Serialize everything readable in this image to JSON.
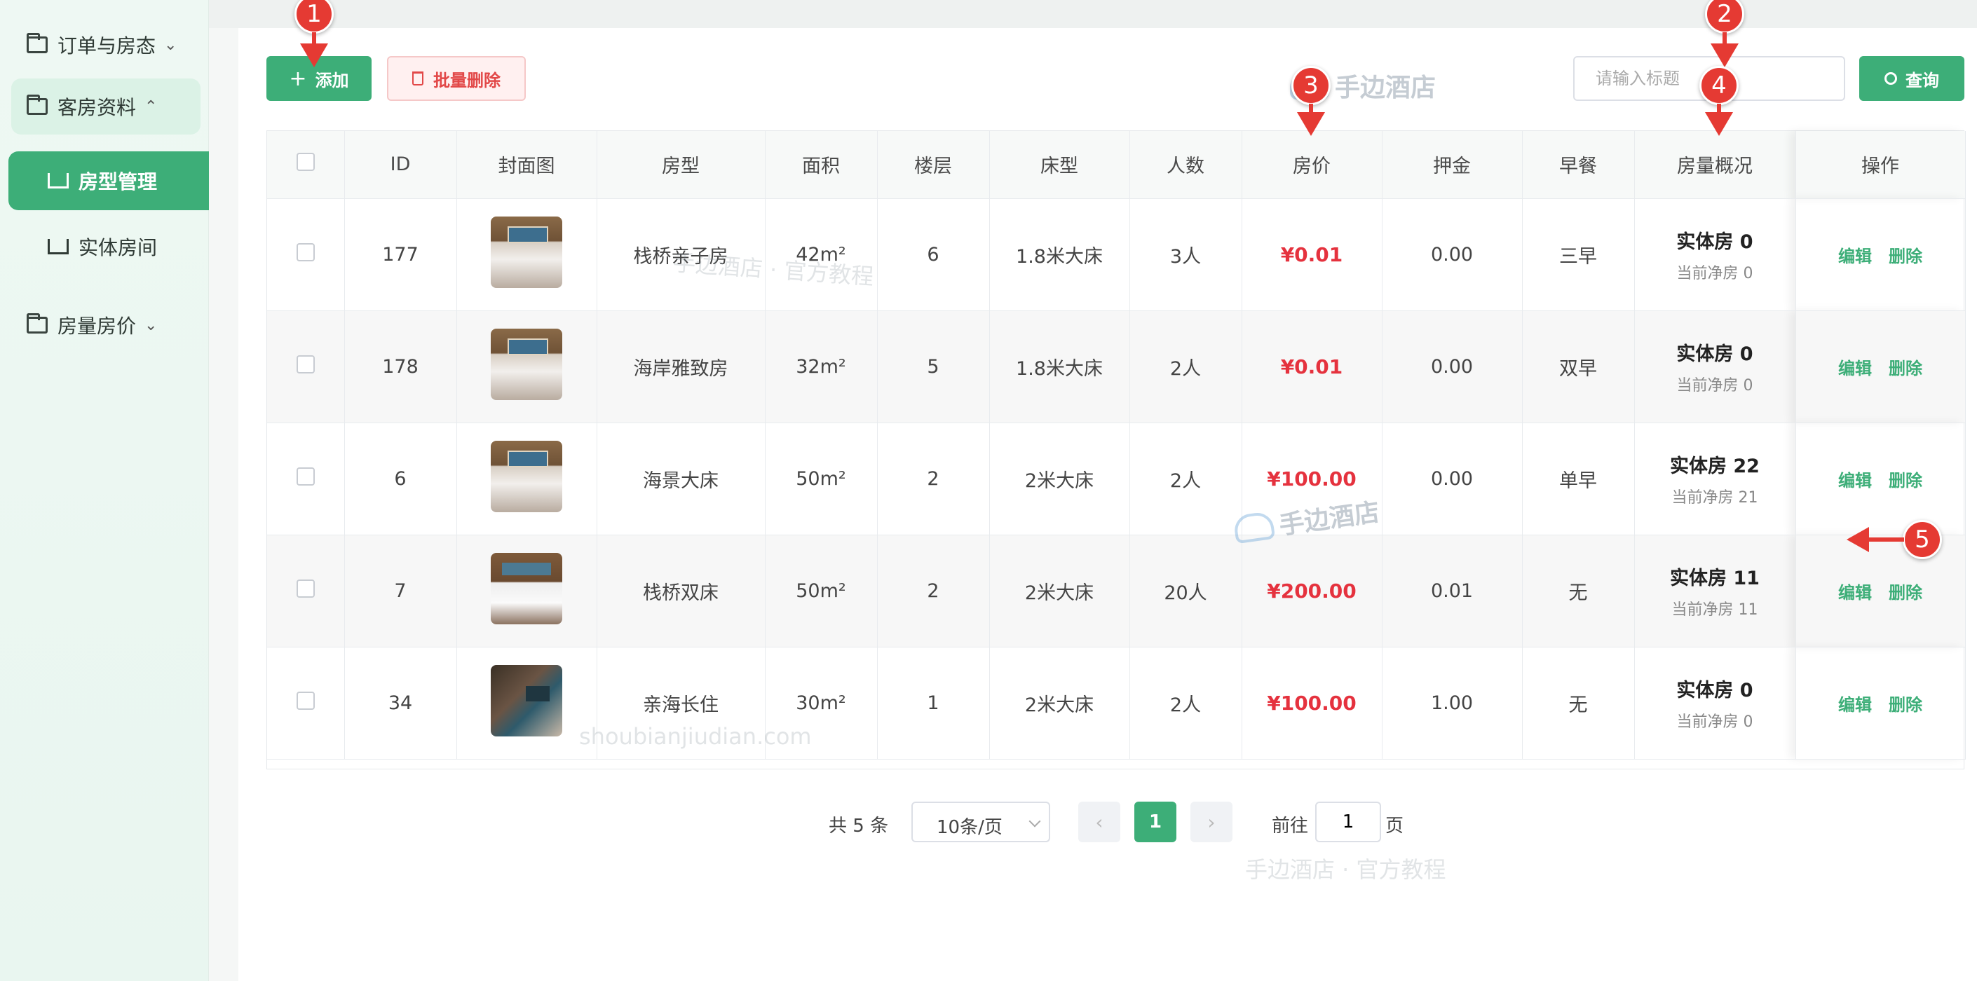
{
  "sidebar": {
    "groups": [
      {
        "label": "订单与房态",
        "chevron": "chevron-down-icon"
      },
      {
        "label": "客房资料",
        "chevron": "chevron-up-icon"
      },
      {
        "label": "房量房价",
        "chevron": "chevron-down-icon"
      }
    ],
    "sub_items": [
      {
        "label": "房型管理",
        "active": true
      },
      {
        "label": "实体房间",
        "active": false
      }
    ]
  },
  "toolbar": {
    "add_label": "添加",
    "batch_delete_label": "批量删除",
    "search_placeholder": "请输入标题",
    "query_label": "查询"
  },
  "table": {
    "headers": [
      "",
      "ID",
      "封面图",
      "房型",
      "面积",
      "楼层",
      "床型",
      "人数",
      "房价",
      "押金",
      "早餐",
      "房量概况",
      "操作"
    ],
    "rows": [
      {
        "id": "177",
        "thumb": "bed",
        "room_type": "栈桥亲子房",
        "area": "42m²",
        "floor": "6",
        "bed": "1.8米大床",
        "people": "3人",
        "price": "¥0.01",
        "deposit": "0.00",
        "breakfast": "三早",
        "inv_main": "实体房 0",
        "inv_sub": "当前净房 0"
      },
      {
        "id": "178",
        "thumb": "bed",
        "room_type": "海岸雅致房",
        "area": "32m²",
        "floor": "5",
        "bed": "1.8米大床",
        "people": "2人",
        "price": "¥0.01",
        "deposit": "0.00",
        "breakfast": "双早",
        "inv_main": "实体房 0",
        "inv_sub": "当前净房 0"
      },
      {
        "id": "6",
        "thumb": "bed",
        "room_type": "海景大床",
        "area": "50m²",
        "floor": "2",
        "bed": "2米大床",
        "people": "2人",
        "price": "¥100.00",
        "deposit": "0.00",
        "breakfast": "单早",
        "inv_main": "实体房 22",
        "inv_sub": "当前净房 21"
      },
      {
        "id": "7",
        "thumb": "twin",
        "room_type": "栈桥双床",
        "area": "50m²",
        "floor": "2",
        "bed": "2米大床",
        "people": "20人",
        "price": "¥200.00",
        "deposit": "0.01",
        "breakfast": "无",
        "inv_main": "实体房 11",
        "inv_sub": "当前净房 11"
      },
      {
        "id": "34",
        "thumb": "suite",
        "room_type": "亲海长住",
        "area": "30m²",
        "floor": "1",
        "bed": "2米大床",
        "people": "2人",
        "price": "¥100.00",
        "deposit": "1.00",
        "breakfast": "无",
        "inv_main": "实体房 0",
        "inv_sub": "当前净房 0"
      }
    ],
    "op_edit": "编辑",
    "op_delete": "删除"
  },
  "pagination": {
    "total": "共 5 条",
    "page_size": "10条/页",
    "prev": "‹",
    "current": "1",
    "next": "›",
    "goto_label": "前往",
    "goto_value": "1",
    "page_suffix": "页"
  },
  "watermarks": {
    "brand": "手边酒店",
    "tutorial": "手边酒店 · 官方教程",
    "domain": "shoubianjiudian.com"
  },
  "markers": [
    "1",
    "2",
    "3",
    "4",
    "5"
  ],
  "colors": {
    "accent": "#3dae78",
    "danger": "#e5323e",
    "marker": "#e53a33"
  }
}
